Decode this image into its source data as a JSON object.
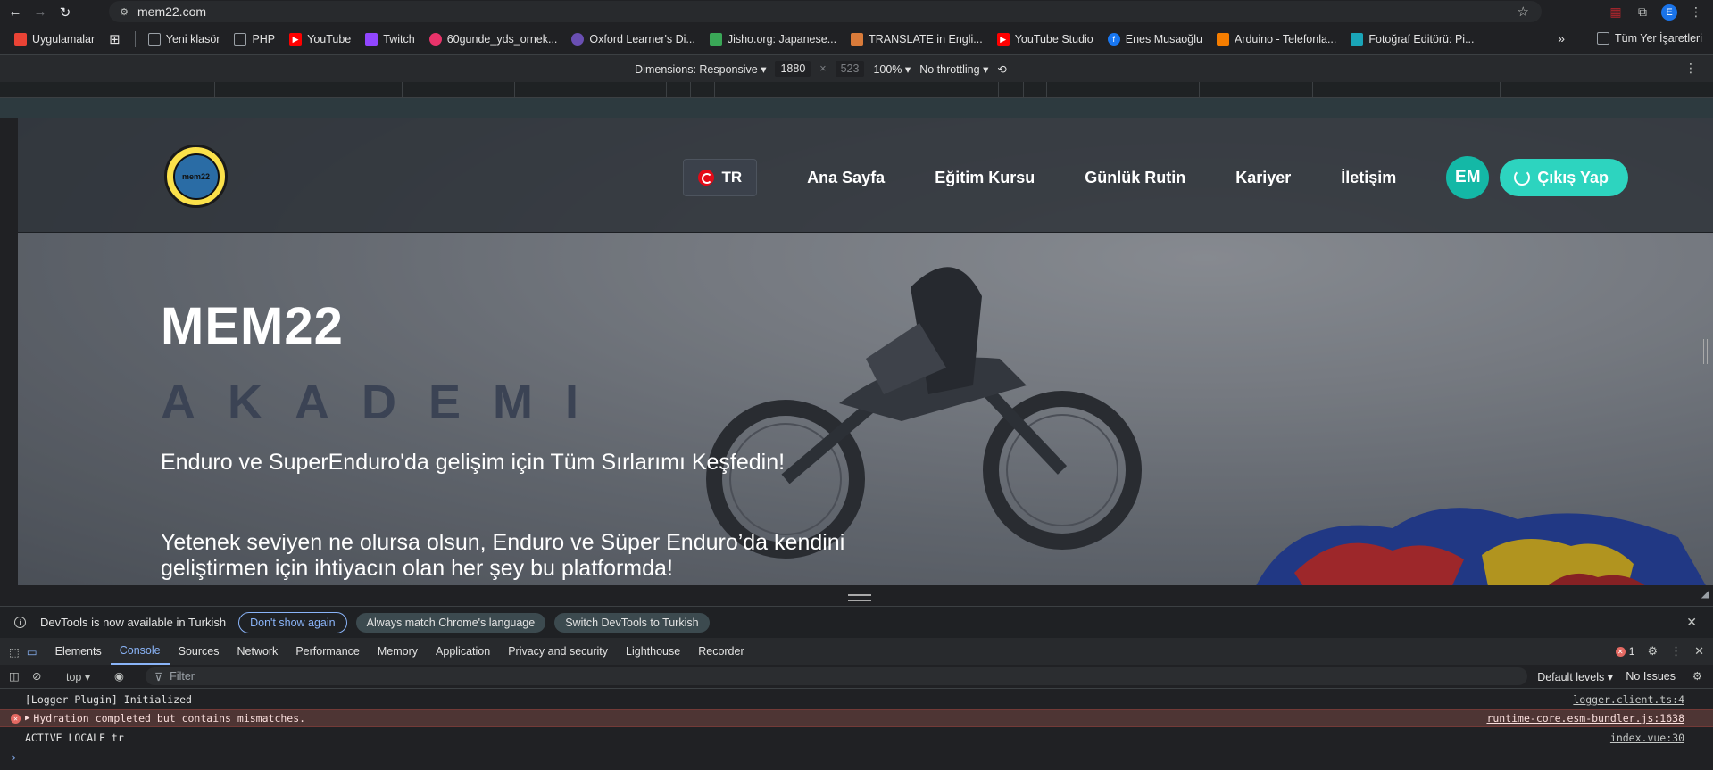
{
  "browser": {
    "url": "mem22.com",
    "profile_initial": "E"
  },
  "bookmarks": {
    "items": [
      {
        "label": "Uygulamalar",
        "icon": "apps-grid-icon",
        "color": "#ea4335"
      },
      {
        "label": "Yeni klasör",
        "icon": "folder-icon",
        "color": "#9aa0a6"
      },
      {
        "label": "PHP",
        "icon": "folder-icon",
        "color": "#9aa0a6"
      },
      {
        "label": "YouTube",
        "icon": "youtube-icon",
        "color": "#ff0000"
      },
      {
        "label": "Twitch",
        "icon": "twitch-icon",
        "color": "#9146ff"
      },
      {
        "label": "60gunde_yds_ornek...",
        "icon": "site-icon",
        "color": "#e8336a"
      },
      {
        "label": "Oxford Learner's Di...",
        "icon": "site-icon",
        "color": "#6a4fb3"
      },
      {
        "label": "Jisho.org: Japanese...",
        "icon": "site-icon",
        "color": "#3aa757"
      },
      {
        "label": "TRANSLATE in Engli...",
        "icon": "site-icon",
        "color": "#d97b3a"
      },
      {
        "label": "YouTube Studio",
        "icon": "youtube-icon",
        "color": "#ff0000"
      },
      {
        "label": "Enes Musaoğlu",
        "icon": "facebook-icon",
        "color": "#1877f2"
      },
      {
        "label": "Arduino - Telefonla...",
        "icon": "blogger-icon",
        "color": "#f57d00"
      },
      {
        "label": "Fotoğraf Editörü: Pi...",
        "icon": "site-icon",
        "color": "#1aa5b8"
      }
    ],
    "all_label": "Tüm Yer İşaretleri"
  },
  "device_toolbar": {
    "dimensions_label": "Dimensions: Responsive",
    "width": "1880",
    "times": "×",
    "height": "523",
    "zoom": "100%",
    "throttling": "No throttling"
  },
  "site": {
    "lang": "TR",
    "nav": [
      "Ana Sayfa",
      "Eğitim Kursu",
      "Günlük Rutin",
      "Kariyer",
      "İletişim"
    ],
    "avatar": "EM",
    "logout": "Çıkış Yap",
    "logo_text": "mem22",
    "hero_title": "MEM22",
    "hero_sub": "AKADEMI",
    "hero_p1": "Enduro ve SuperEnduro'da gelişim için Tüm Sırlarımı Keşfedin!",
    "hero_p2": "Yetenek seviyen ne olursa olsun, Enduro ve Süper Enduro’da kendini geliştirmen için ihtiyacın olan her şey bu platformda!"
  },
  "devtools": {
    "notice": "DevTools is now available in Turkish",
    "btn_dont_show": "Don't show again",
    "btn_match": "Always match Chrome's language",
    "btn_switch": "Switch DevTools to Turkish",
    "tabs": [
      "Elements",
      "Console",
      "Sources",
      "Network",
      "Performance",
      "Memory",
      "Application",
      "Privacy and security",
      "Lighthouse",
      "Recorder"
    ],
    "active_tab": "Console",
    "error_count": "1",
    "context": "top",
    "filter_placeholder": "Filter",
    "levels": "Default levels",
    "issues": "No Issues",
    "logs": [
      {
        "text": "[Logger Plugin] Initialized",
        "source": "logger.client.ts:4",
        "type": "log"
      },
      {
        "text": "Hydration completed but contains mismatches.",
        "source": "runtime-core.esm-bundler.js:1638",
        "type": "error"
      },
      {
        "text": "ACTIVE LOCALE tr",
        "source": "index.vue:30",
        "type": "log"
      }
    ]
  },
  "colors": {
    "accent": "#2dd4bf",
    "avatar": "#14b8a6",
    "devtools_accent": "#8ab4f8",
    "error_bg": "#4e3534"
  }
}
